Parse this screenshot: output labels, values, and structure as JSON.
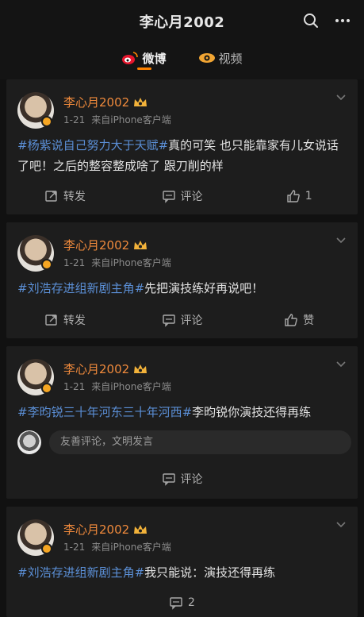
{
  "header": {
    "title": "李心月2002",
    "tabs": [
      {
        "label": "微博",
        "active": true
      },
      {
        "label": "视频",
        "active": false
      }
    ]
  },
  "colors": {
    "accent": "#ff8200",
    "username": "#f08a3c",
    "hashtag": "#5b8fd6"
  },
  "posts": [
    {
      "username": "李心月2002",
      "date": "1-21",
      "source": "来自iPhone客户端",
      "tag": "#杨紫说自己努力大于天赋#",
      "body": "真的可笑 也只能靠家有儿女说话了吧！之后的整容整成啥了 跟刀削的样",
      "repost": "转发",
      "comment": "评论",
      "like": "1"
    },
    {
      "username": "李心月2002",
      "date": "1-21",
      "source": "来自iPhone客户端",
      "tag": "#刘浩存进组新剧主角#",
      "body": "先把演技练好再说吧！",
      "repost": "转发",
      "comment": "评论",
      "like": "赞"
    },
    {
      "username": "李心月2002",
      "date": "1-21",
      "source": "来自iPhone客户端",
      "tag": "#李昀锐三十年河东三十年河西#",
      "body": "李昀锐你演技还得再练",
      "comment_placeholder": "友善评论，文明发言",
      "comment": "评论"
    },
    {
      "username": "李心月2002",
      "date": "1-21",
      "source": "来自iPhone客户端",
      "tag": "#刘浩存进组新剧主角#",
      "body": "我只能说：演技还得再练",
      "comment_count": "2"
    }
  ]
}
